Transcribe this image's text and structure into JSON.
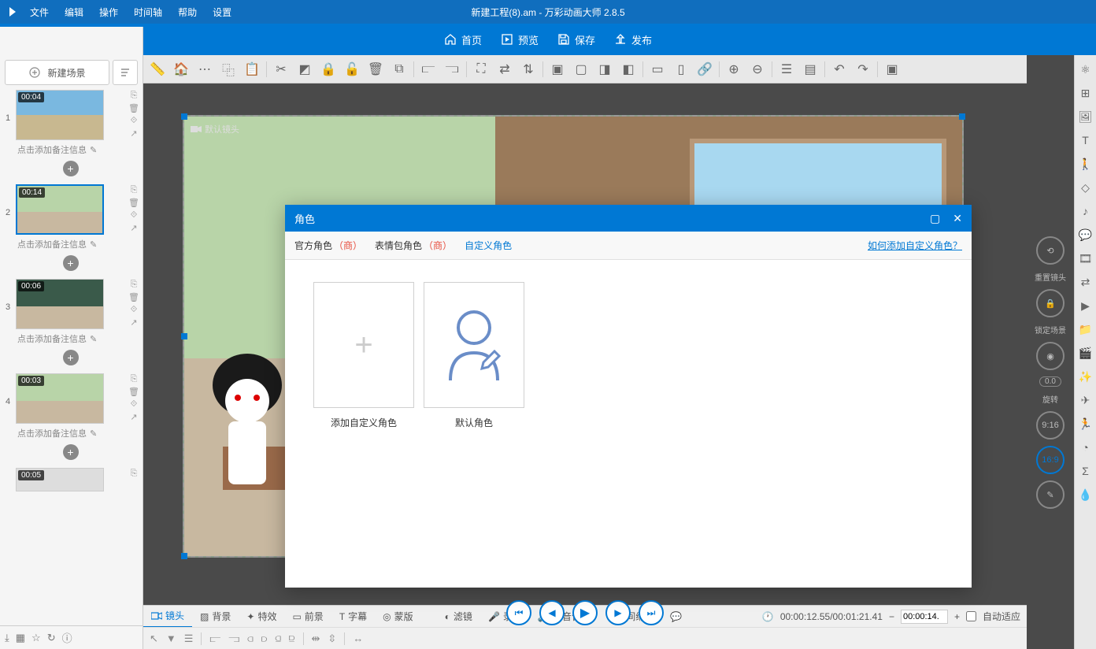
{
  "title": "新建工程(8).am - 万彩动画大师 2.8.5",
  "menu": [
    "文件",
    "编辑",
    "操作",
    "时间轴",
    "帮助",
    "设置"
  ],
  "actions": {
    "home": "首页",
    "preview": "预览",
    "save": "保存",
    "publish": "发布"
  },
  "sidebar": {
    "new_scene": "新建场景",
    "scenes": [
      {
        "time": "00:04",
        "note": "点击添加备注信息"
      },
      {
        "time": "00:14",
        "note": "点击添加备注信息"
      },
      {
        "time": "00:06",
        "note": "点击添加备注信息"
      },
      {
        "time": "00:03",
        "note": "点击添加备注信息"
      },
      {
        "time": "00:05",
        "note": ""
      }
    ]
  },
  "canvas": {
    "camera_label": "默认镜头"
  },
  "right_col": {
    "reset_camera": "重置镜头",
    "lock_scene": "锁定场景",
    "rotate": "旋转",
    "rot_val": "0.0",
    "ratio": "9:16",
    "aspect": "16:9"
  },
  "bottom": {
    "tabs": [
      "镜头",
      "背景",
      "特效",
      "前景",
      "字幕",
      "蒙版"
    ],
    "tools": [
      "滤镜",
      "录音",
      "语音合成",
      "时间缩放"
    ],
    "time_display": "00:00:12.55/00:01:21.41",
    "time_input": "00:00:14.",
    "auto_fit": "自动适应"
  },
  "modal": {
    "title": "角色",
    "tabs": {
      "official": "官方角色",
      "emoji": "表情包角色",
      "paid": "（商）",
      "custom": "自定义角色"
    },
    "help_link": "如何添加自定义角色？",
    "add_custom": "添加自定义角色",
    "default_role": "默认角色"
  }
}
